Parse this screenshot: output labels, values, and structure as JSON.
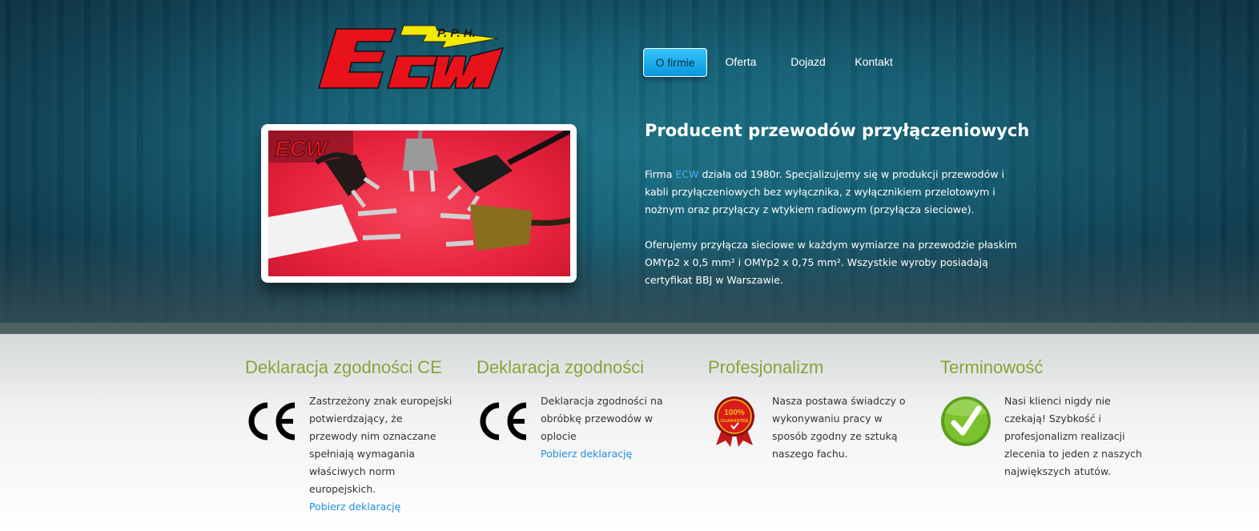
{
  "header": {
    "logo_text": "ECW",
    "logo_subtext": "P. P. H."
  },
  "nav": {
    "items": [
      {
        "label": "O firmie",
        "active": true
      },
      {
        "label": "Oferta",
        "active": false
      },
      {
        "label": "Dojazd",
        "active": false
      },
      {
        "label": "Kontakt",
        "active": false
      }
    ]
  },
  "hero": {
    "title": "Producent przewodów przyłączeniowych",
    "p1_before": "Firma ",
    "p1_brand": "ECW",
    "p1_after": " działa od 1980r. Specjalizujemy się w produkcji przewodów i kabli przyłączeniowych bez wyłącznika, z wyłącznikiem przelotowym i nożnym oraz przyłączy z wtykiem radiowym (przyłącza sieciowe).",
    "p2": "Oferujemy przyłącza sieciowe w każdym wymiarze na przewodzie płaskim OMYp2 x 0,5 mm² i OMYp2 x 0,75 mm². Wszystkie wyroby posiadają certyfikat BBJ w Warszawie.",
    "photo_logo": "ECW"
  },
  "features": [
    {
      "title": "Deklaracja zgodności CE",
      "icon": "ce-mark-icon",
      "text": "Zastrzeżony znak europejski potwierdzający, że przewody nim oznaczane spełniają wymagania właściwych norm europejskich.",
      "link": "Pobierz deklarację"
    },
    {
      "title": "Deklaracja zgodności",
      "icon": "ce-mark-icon",
      "text": "Deklaracja zgodności na obróbkę przewodów w oplocie",
      "link": "Pobierz deklarację"
    },
    {
      "title": "Profesjonalizm",
      "icon": "guarantee-seal-icon",
      "icon_text": "100% GUARANTEE",
      "text": "Nasza postawa świadczy o wykonywaniu pracy w sposób zgodny ze sztuką naszego fachu."
    },
    {
      "title": "Terminowość",
      "icon": "checkmark-icon",
      "text": "Nasi klienci nigdy nie czekają! Szybkość i profesjonalizm realizacji zlecenia to jeden z naszych największych atutów."
    }
  ],
  "colors": {
    "accent_blue": "#1f8fe0",
    "feature_green": "#86a53a",
    "logo_red": "#e8121b",
    "logo_yellow": "#f4e900"
  }
}
